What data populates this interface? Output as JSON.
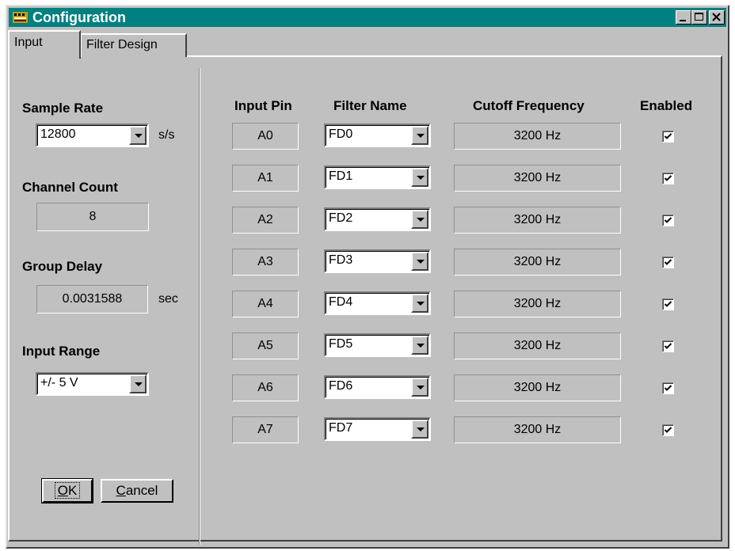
{
  "window": {
    "title": "Configuration"
  },
  "tabs": [
    "Input",
    "Filter Design"
  ],
  "left": {
    "sample_rate": {
      "label": "Sample Rate",
      "value": "12800",
      "unit": "s/s"
    },
    "channel_count": {
      "label": "Channel Count",
      "value": "8"
    },
    "group_delay": {
      "label": "Group Delay",
      "value": "0.0031588",
      "unit": "sec"
    },
    "input_range": {
      "label": "Input Range",
      "value": "+/- 5 V"
    }
  },
  "table": {
    "headers": {
      "pin": "Input Pin",
      "filter": "Filter Name",
      "cutoff": "Cutoff Frequency",
      "enabled": "Enabled"
    },
    "rows": [
      {
        "pin": "A0",
        "filter": "FD0",
        "cutoff": "3200 Hz",
        "enabled": true
      },
      {
        "pin": "A1",
        "filter": "FD1",
        "cutoff": "3200 Hz",
        "enabled": true
      },
      {
        "pin": "A2",
        "filter": "FD2",
        "cutoff": "3200 Hz",
        "enabled": true
      },
      {
        "pin": "A3",
        "filter": "FD3",
        "cutoff": "3200 Hz",
        "enabled": true
      },
      {
        "pin": "A4",
        "filter": "FD4",
        "cutoff": "3200 Hz",
        "enabled": true
      },
      {
        "pin": "A5",
        "filter": "FD5",
        "cutoff": "3200 Hz",
        "enabled": true
      },
      {
        "pin": "A6",
        "filter": "FD6",
        "cutoff": "3200 Hz",
        "enabled": true
      },
      {
        "pin": "A7",
        "filter": "FD7",
        "cutoff": "3200 Hz",
        "enabled": true
      }
    ]
  },
  "buttons": {
    "ok": "OK",
    "cancel": "Cancel"
  },
  "icons": {
    "app": "app-icon",
    "minimize": "minimize-icon",
    "maximize": "maximize-icon",
    "close": "close-icon",
    "dropdown": "chevron-down-icon",
    "check": "checkmark-icon"
  },
  "colors": {
    "titlebar": "#008080",
    "face": "#c0c0c0"
  }
}
